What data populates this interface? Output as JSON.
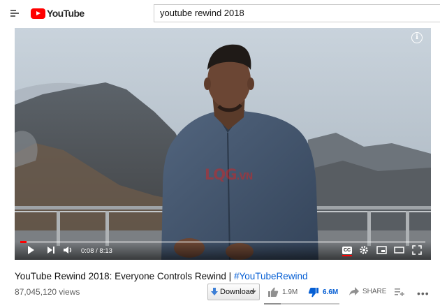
{
  "header": {
    "logo_text": "YouTube",
    "search_value": "youtube rewind 2018"
  },
  "player": {
    "watermark": {
      "big": "LQG",
      "small": ".VN"
    },
    "progress_fraction": 0.016,
    "time": "0:08 / 8:13",
    "cc_label": "CC"
  },
  "video": {
    "title": "YouTube Rewind 2018: Everyone Controls Rewind | ",
    "hashtag": "#YouTubeRewind",
    "views": "87,045,120 views",
    "download_label": "Download",
    "likes": "1.9M",
    "dislikes": "6.6M",
    "share_label": "SHARE",
    "like_ratio": 0.22
  },
  "icons": [
    "menu-icon",
    "youtube-logo-icon",
    "info-icon",
    "play-icon",
    "next-icon",
    "volume-icon",
    "cc-icon",
    "settings-icon",
    "miniplayer-icon",
    "theater-icon",
    "fullscreen-icon",
    "download-icon",
    "thumbs-up-icon",
    "thumbs-down-icon",
    "share-icon",
    "add-to-playlist-icon",
    "more-icon"
  ],
  "colors": {
    "brand_red": "#ff0000",
    "link_blue": "#065fd4",
    "dislike_blue": "#065fd4"
  }
}
